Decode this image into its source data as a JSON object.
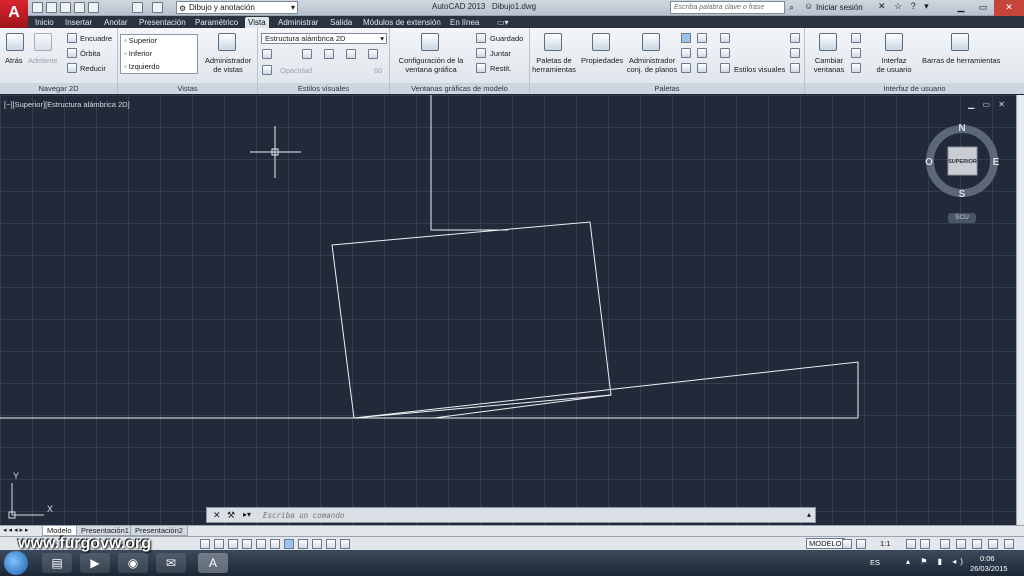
{
  "titlebar": {
    "workspace": "Dibujo y anotación",
    "app_title": "AutoCAD 2013",
    "file_name": "Dibujo1.dwg",
    "search_placeholder": "Escriba palabra clave o frase",
    "signin": "Iniciar sesión"
  },
  "menu": {
    "tabs": [
      "Inicio",
      "Insertar",
      "Anotar",
      "Presentación",
      "Paramétrico",
      "Vista",
      "Administrar",
      "Salida",
      "Módulos de extensión",
      "En línea"
    ],
    "active_tab": "Vista"
  },
  "ribbon": {
    "navegar": {
      "title": "Navegar 2D",
      "atras": "Atrás",
      "adelante": "Adelante",
      "encuadre": "Encuadre",
      "orbita": "Órbita",
      "reducir": "Reducir"
    },
    "vistas": {
      "title": "Vistas",
      "items": [
        "Superior",
        "Inferior",
        "Izquierdo"
      ],
      "admin": [
        "Administrador",
        "de vistas"
      ]
    },
    "estilos": {
      "title": "Estilos visuales",
      "current": "Estructura alámbrica 2D",
      "opacity_label": "Opacidad",
      "opacity_value": "60"
    },
    "ventanas": {
      "title": "Ventanas gráficas de modelo",
      "config": [
        "Configuración de la",
        "ventana gráfica"
      ],
      "guardado": "Guardado",
      "juntar": "Juntar",
      "restit": "Restit."
    },
    "paletas": {
      "title": "Paletas",
      "herramientas": [
        "Paletas de",
        "herramientas"
      ],
      "propiedades": "Propiedades",
      "admin_planos": [
        "Administrador",
        "conj. de planos"
      ],
      "estilos_visuales": "Estilos visuales"
    },
    "interfaz": {
      "title": "Interfaz de usuario",
      "cambiar": [
        "Cambiar",
        "ventanas"
      ],
      "interfaz": [
        "Interfaz",
        "de usuario"
      ],
      "barras": "Barras de herramientas"
    }
  },
  "viewport": {
    "label": "[−][Superior][Estructura alámbrica 2D]",
    "compass": {
      "n": "N",
      "s": "S",
      "e": "E",
      "o": "O"
    },
    "cube_face": "SUPERIOR",
    "wcs": "SCU",
    "ucs_x": "X",
    "ucs_y": "Y"
  },
  "command": {
    "placeholder": "Escriba un comando"
  },
  "layouts": {
    "tabs": [
      "Modelo",
      "Presentación1",
      "Presentación2"
    ],
    "active": "Modelo"
  },
  "status": {
    "watermark": "www.furgovw.org",
    "modelo": "MODELO",
    "scale": "1:1"
  },
  "taskbar": {
    "lang": "ES",
    "time": "0:06",
    "date": "26/03/2015"
  }
}
